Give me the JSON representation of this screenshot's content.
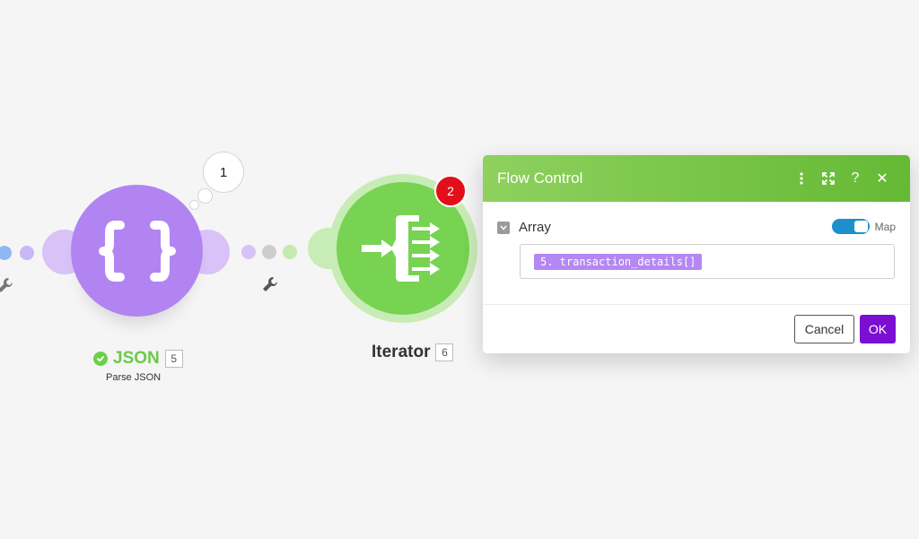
{
  "modules": {
    "json": {
      "title": "JSON",
      "id": "5",
      "subtitle": "Parse JSON",
      "bubble_count": "1",
      "color": "#b184f2"
    },
    "iterator": {
      "title": "Iterator",
      "id": "6",
      "badge_count": "2",
      "color": "#77d351"
    }
  },
  "panel": {
    "title": "Flow Control",
    "field_label": "Array",
    "map_toggle_label": "Map",
    "map_toggle_on": true,
    "mapped_value": "5. transaction_details[]",
    "cancel_label": "Cancel",
    "ok_label": "OK",
    "header_icons": [
      "more-vertical-icon",
      "expand-icon",
      "help-icon",
      "close-icon"
    ],
    "header_glyphs": {
      "help": "?",
      "close": "✕"
    }
  },
  "colors": {
    "accent_green": "#6fc23f",
    "accent_purple": "#7a0fd1",
    "badge_red": "#e20e19",
    "toggle_blue": "#1d8fcb"
  }
}
